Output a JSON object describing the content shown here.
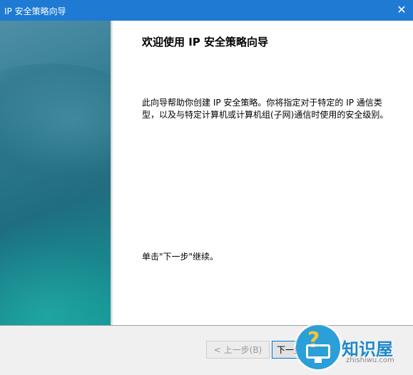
{
  "window": {
    "title": "IP 安全策略向导",
    "close_glyph": "✕"
  },
  "wizard": {
    "heading": "欢迎使用 IP 安全策略向导",
    "description": "此向导帮助你创建 IP 安全策略。你将指定对于特定的 IP 通信类型，以及与特定计算机或计算机组(子网)通信时使用的安全级别。",
    "instruction": "单击\"下一步\"继续。"
  },
  "buttons": {
    "back_label": "< 上一步(B)",
    "next_label": "下一步"
  },
  "watermark": {
    "brand": "知识屋",
    "url": "zhishiwu.com"
  },
  "colors": {
    "titlebar": "#1e7ad2",
    "side_panel": "#1f6d80",
    "accent": "#0078d7"
  }
}
